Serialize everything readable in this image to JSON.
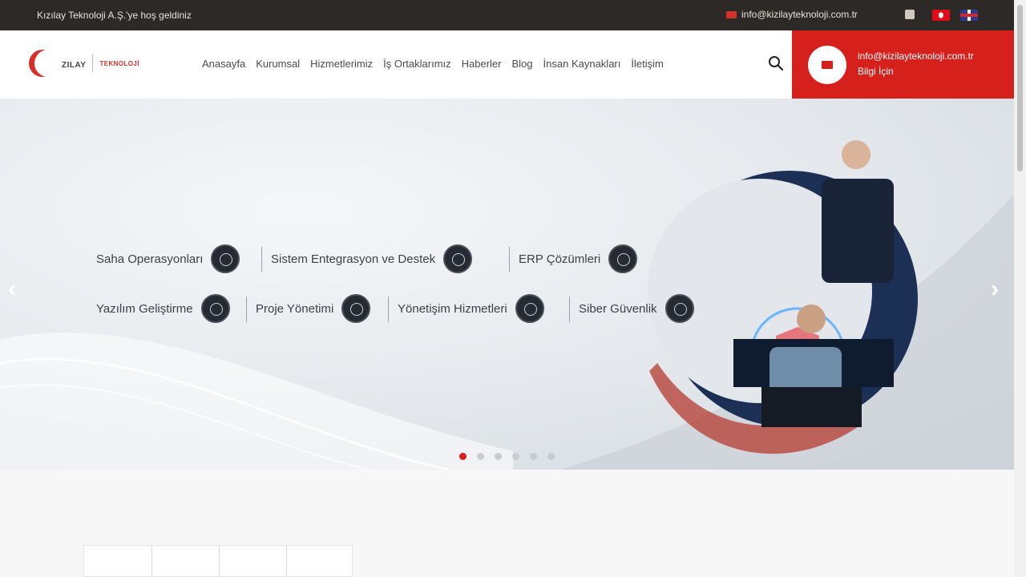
{
  "topbar": {
    "welcome": "Kızılay Teknoloji A.Ş.'ye hoş geldiniz",
    "email": "info@kizilayteknoloji.com.tr",
    "icons": [
      "envelope-icon",
      "social-icon",
      "flag-tr-icon",
      "flag-uk-icon"
    ]
  },
  "header": {
    "logo_word": "KIZILAY",
    "logo_sub": "TEKNOLOJİ",
    "nav": [
      "Anasayfa",
      "Kurumsal",
      "Hizmetlerimiz",
      "İş Ortaklarımız",
      "Haberler",
      "Blog",
      "İnsan Kaynakları",
      "İletişim"
    ],
    "contact_email": "info@kizilayteknoloji.com.tr",
    "contact_sub": "Bilgi İçin"
  },
  "hero": {
    "services_row1": [
      "Saha Operasyonları",
      "Sistem Entegrasyon ve Destek",
      "ERP Çözümleri"
    ],
    "services_row2": [
      "Yazılım Geliştirme",
      "Proje Yönetimi",
      "Yönetişim Hizmetleri",
      "Siber Güvenlik"
    ],
    "arrow_left": "‹",
    "arrow_right": "›",
    "slides_total": 6,
    "active_slide": 1
  },
  "colors": {
    "accent": "#d6201c",
    "topbar": "#2d2926"
  }
}
